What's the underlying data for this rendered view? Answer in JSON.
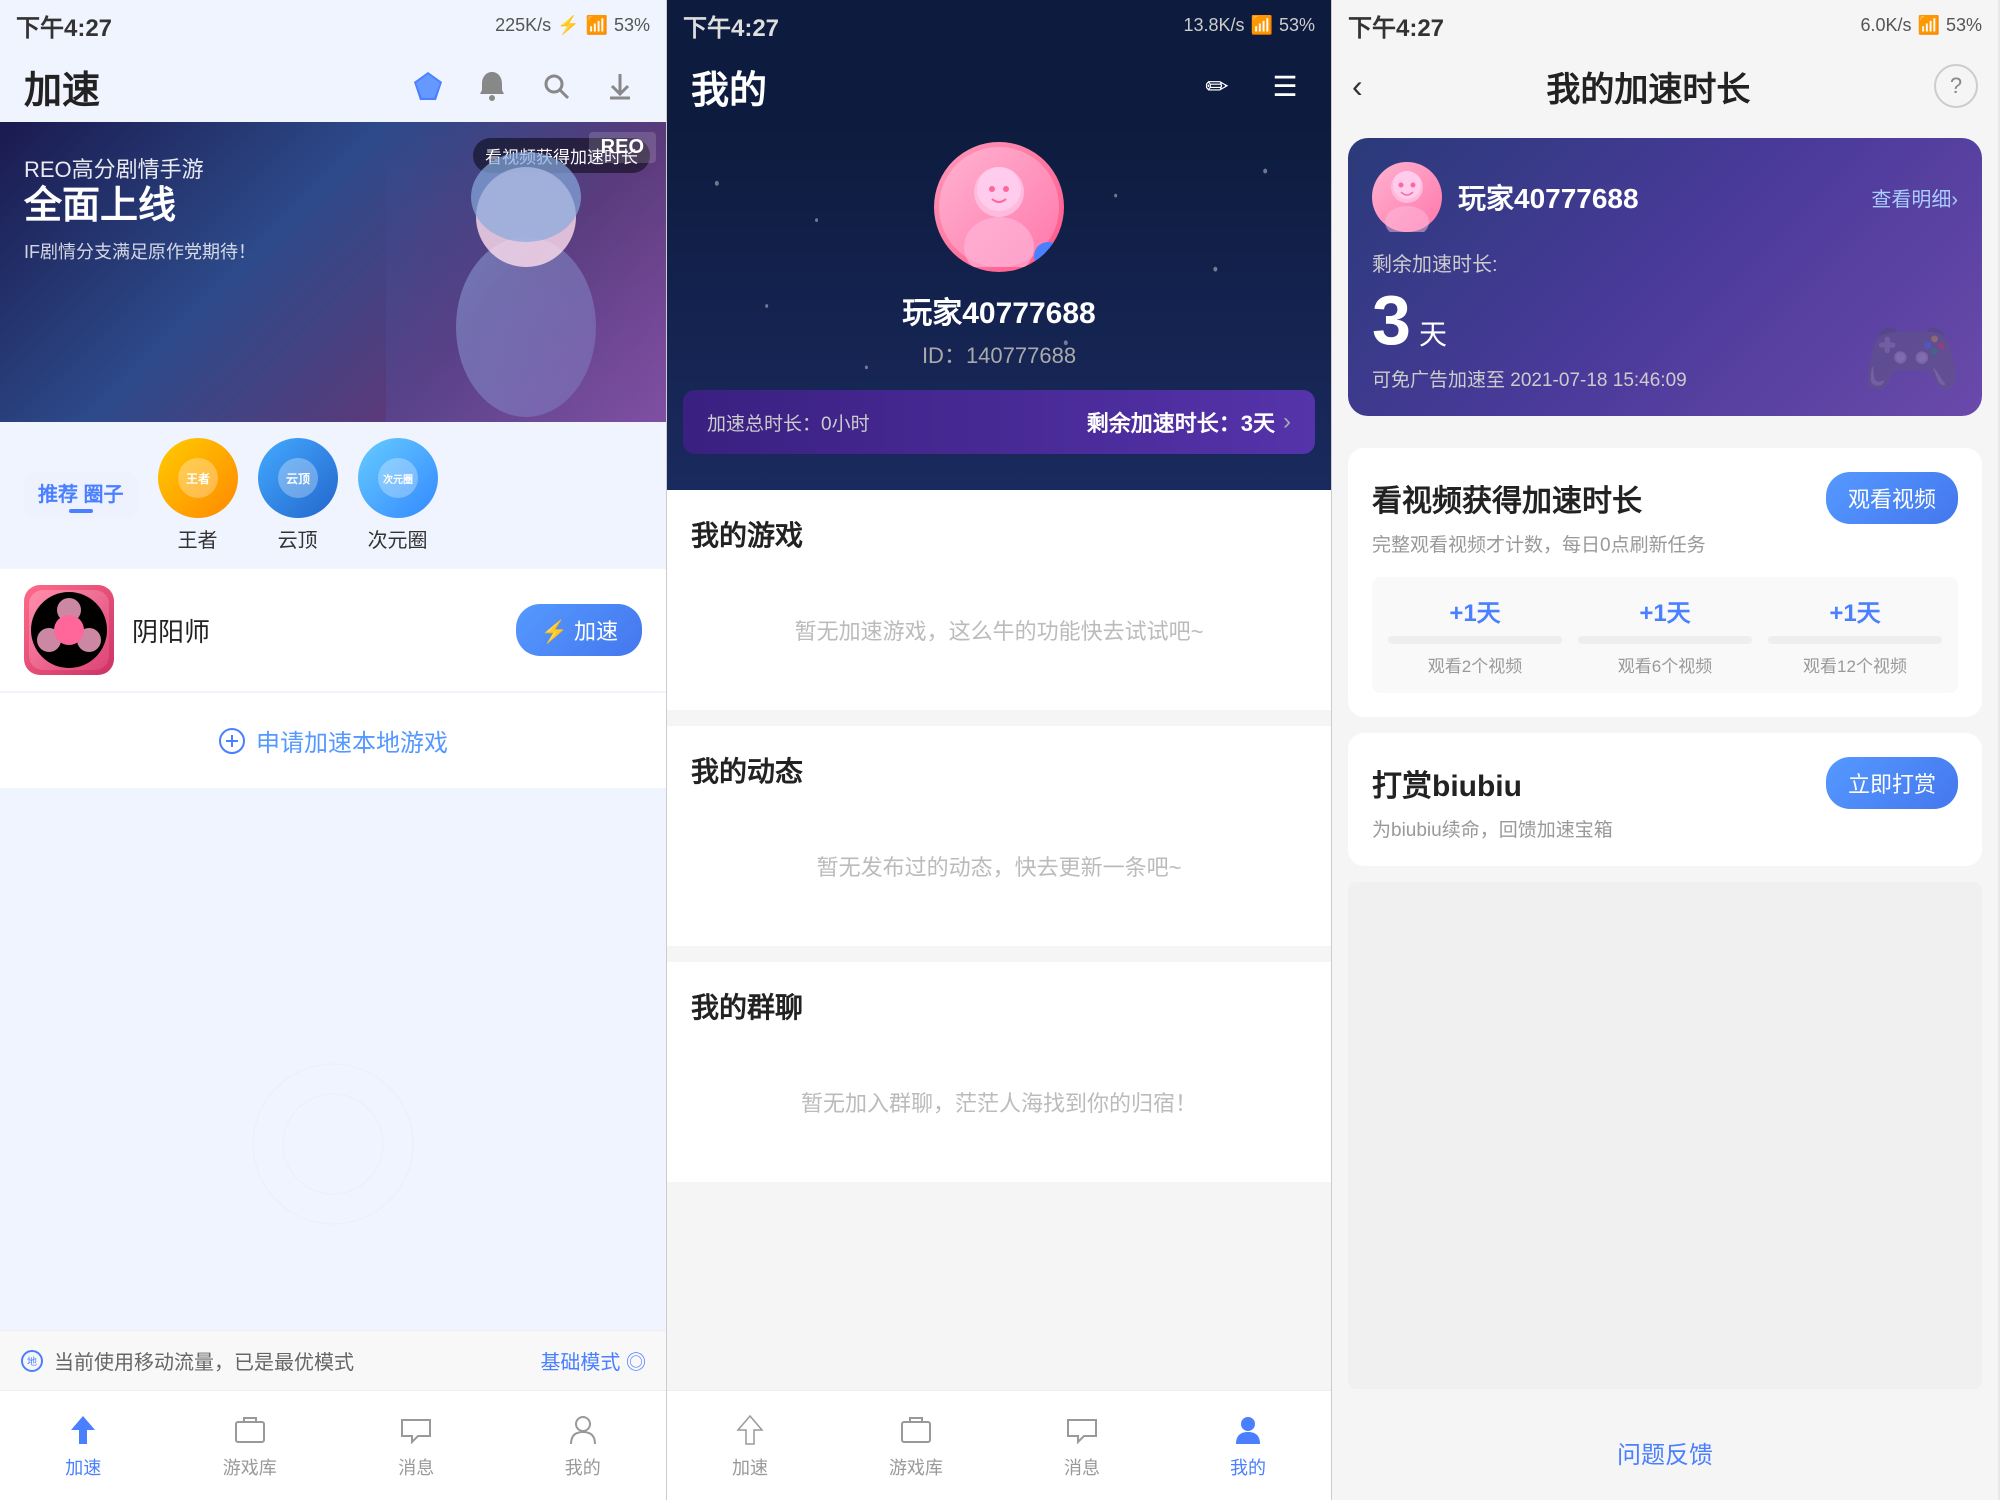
{
  "panel1": {
    "status": {
      "time": "下午4:27",
      "speed": "225K/s",
      "battery": "53%"
    },
    "header": {
      "title": "加速",
      "icon_diamond": "◆",
      "icon_bell": "🔔",
      "icon_search": "🔍",
      "icon_download": "⬇"
    },
    "banner": {
      "video_btn": "看视频获得加速时长",
      "badge": "REO",
      "sub_title": "REO高分剧情手游",
      "main_title": "全面上线",
      "desc": "IF剧情分支满足原作党期待！"
    },
    "categories": {
      "active": "推荐\n圈子",
      "items": [
        {
          "name": "王者",
          "color1": "#ffcc00",
          "color2": "#ff8800"
        },
        {
          "name": "云顶",
          "color1": "#44aaff",
          "color2": "#2266cc"
        },
        {
          "name": "次元圈",
          "color1": "#66ccff",
          "color2": "#3388ff"
        }
      ]
    },
    "game": {
      "name": "阴阳师",
      "speed_btn": "⚡ 加速"
    },
    "apply_local": "申请加速本地游戏",
    "data_usage": "当前使用移动流量，已是最优模式",
    "mode_link": "基础模式 ◎",
    "nav": {
      "items": [
        {
          "label": "加速",
          "active": true
        },
        {
          "label": "游戏库",
          "active": false
        },
        {
          "label": "消息",
          "active": false
        },
        {
          "label": "我的",
          "active": false
        }
      ]
    }
  },
  "panel2": {
    "status": {
      "time": "下午4:27",
      "speed": "13.8K/s",
      "battery": "53%"
    },
    "header": {
      "title": "我的",
      "icon_edit": "✏",
      "icon_menu": "☰"
    },
    "profile": {
      "username": "玩家40777688",
      "user_id": "ID：140777688",
      "avatar_gender": "♂"
    },
    "stats": {
      "total_label": "加速总时长：0小时",
      "remaining_label": "剩余加速时长：3天",
      "arrow": "›"
    },
    "sections": {
      "games": {
        "title": "我的游戏",
        "empty": "暂无加速游戏，这么牛的功能快去试试吧~"
      },
      "moments": {
        "title": "我的动态",
        "empty": "暂无发布过的动态，快去更新一条吧~"
      },
      "groups": {
        "title": "我的群聊",
        "empty": "暂无加入群聊，茫茫人海找到你的归宿！"
      }
    },
    "nav": {
      "items": [
        {
          "label": "加速",
          "active": false
        },
        {
          "label": "游戏库",
          "active": false
        },
        {
          "label": "消息",
          "active": false
        },
        {
          "label": "我的",
          "active": true
        }
      ]
    }
  },
  "panel3": {
    "status": {
      "time": "下午4:27",
      "speed": "6.0K/s",
      "battery": "53%"
    },
    "header": {
      "back": "‹",
      "title": "我的加速时长",
      "help": "?"
    },
    "speed_card": {
      "username": "玩家40777688",
      "detail_link": "查看明细›",
      "remaining_label": "剩余加速时长:",
      "days": "3",
      "unit": "天",
      "expiry": "可免广告加速至 2021-07-18 15:46:09"
    },
    "watch_video": {
      "title": "看视频获得加速时长",
      "btn": "观看视频",
      "desc": "完整观看视频才计数，每日0点刷新任务",
      "rewards": [
        {
          "plus": "+1天",
          "label": "观看2个视频"
        },
        {
          "plus": "+1天",
          "label": "观看6个视频"
        },
        {
          "plus": "+1天",
          "label": "观看12个视频"
        }
      ]
    },
    "donate": {
      "title": "打赏biubiu",
      "btn": "立即打赏",
      "desc": "为biubiu续命，回馈加速宝箱"
    },
    "feedback": "问题反馈"
  }
}
